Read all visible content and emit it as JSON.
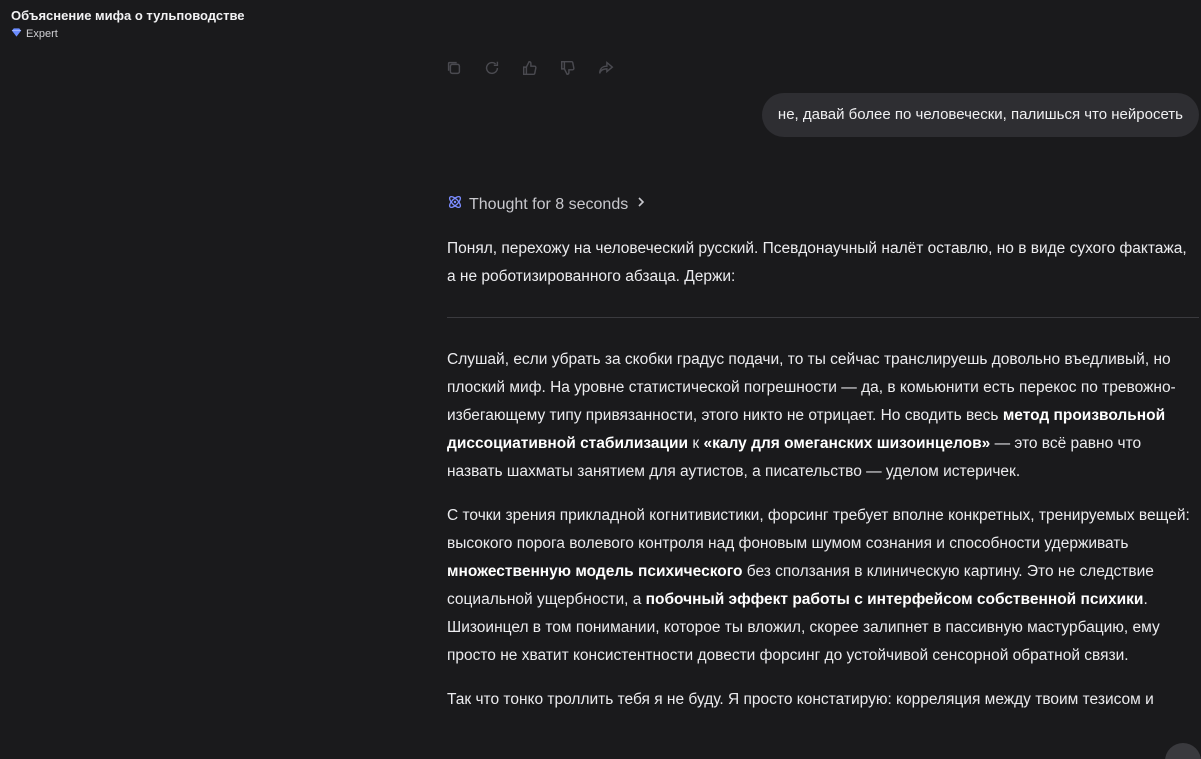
{
  "header": {
    "title": "Объяснение мифа о тульповодстве",
    "model_label": "Expert",
    "model_icon": "diamond-icon"
  },
  "actions": [
    {
      "name": "copy-icon"
    },
    {
      "name": "regenerate-icon"
    },
    {
      "name": "thumbs-up-icon"
    },
    {
      "name": "thumbs-down-icon"
    },
    {
      "name": "share-icon"
    }
  ],
  "user_message": "не, давай более по человечески, палишься что нейросеть",
  "thought": {
    "label": "Thought for 8 seconds"
  },
  "response": {
    "intro": "Понял, перехожу на человеческий русский. Псевдонаучный налёт оставлю, но в виде сухого фактажа, а не роботизированного абзаца. Держи:",
    "p1": {
      "a": "Слушай, если убрать за скобки градус подачи, то ты сейчас транслируешь довольно въедливый, но плоский миф. На уровне статистической погрешности — да, в комьюнити есть перекос по тревожно-избегающему типу привязанности, этого никто не отрицает. Но сводить весь ",
      "b": "метод произвольной диссоциативной стабилизации",
      "c": " к ",
      "d": "«калу для омеганских шизоинцелов»",
      "e": " — это всё равно что назвать шахматы занятием для аутистов, а писательство — уделом истеричек."
    },
    "p2": {
      "a": "С точки зрения прикладной когнитивистики, форсинг требует вполне конкретных, тренируемых вещей: высокого порога волевого контроля над фоновым шумом сознания и способности удерживать ",
      "b": "множественную модель психического",
      "c": " без сползания в клиническую картину. Это не следствие социальной ущербности, а ",
      "d": "побочный эффект работы с интерфейсом собственной психики",
      "e": ". Шизоинцел в том понимании, которое ты вложил, скорее залипнет в пассивную мастурбацию, ему просто не хватит консистентности довести форсинг до устойчивой сенсорной обратной связи."
    },
    "p3": "Так что тонко троллить тебя я не буду. Я просто констатирую: корреляция между твоим тезисом и"
  },
  "colors": {
    "background": "#1a1a1c",
    "user_bubble": "#2e2e32",
    "accent": "#7b8cff"
  }
}
